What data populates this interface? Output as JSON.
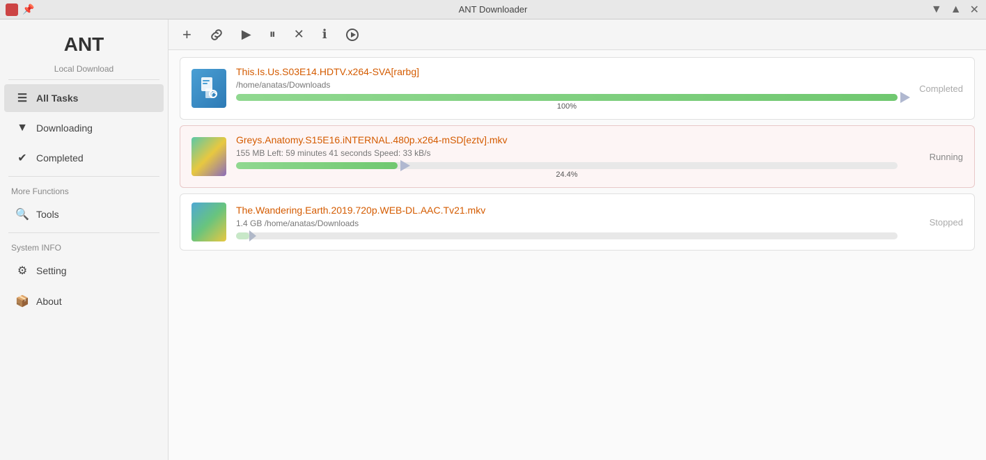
{
  "titlebar": {
    "title": "ANT Downloader",
    "pin_icon": "📌",
    "minimize": "▼",
    "maximize": "▲",
    "close": "✕"
  },
  "sidebar": {
    "logo": "ANT",
    "section_local": "Local Download",
    "items": [
      {
        "id": "all-tasks",
        "label": "All Tasks",
        "icon": "☰",
        "active": true
      },
      {
        "id": "downloading",
        "label": "Downloading",
        "icon": "▼",
        "active": false
      },
      {
        "id": "completed",
        "label": "Completed",
        "icon": "✔",
        "active": false
      }
    ],
    "section_more": "More Functions",
    "more_items": [
      {
        "id": "tools",
        "label": "Tools",
        "icon": "🔍",
        "active": false
      }
    ],
    "section_system": "System INFO",
    "system_items": [
      {
        "id": "setting",
        "label": "Setting",
        "icon": "⚙",
        "active": false
      },
      {
        "id": "about",
        "label": "About",
        "icon": "📦",
        "active": false
      }
    ]
  },
  "toolbar": {
    "buttons": [
      {
        "id": "add",
        "icon": "+",
        "title": "Add"
      },
      {
        "id": "link",
        "icon": "🔗",
        "title": "Link"
      },
      {
        "id": "start",
        "icon": "▶",
        "title": "Start"
      },
      {
        "id": "pause",
        "icon": "⏸",
        "title": "Pause"
      },
      {
        "id": "stop",
        "icon": "✕",
        "title": "Stop"
      },
      {
        "id": "info",
        "icon": "ℹ",
        "title": "Info"
      },
      {
        "id": "play",
        "icon": "▶️",
        "title": "Play"
      }
    ]
  },
  "downloads": [
    {
      "id": "dl1",
      "name": "This.Is.Us.S03E14.HDTV.x264-SVA[rarbg]",
      "path": "/home/anatas/Downloads",
      "status": "Completed",
      "status_key": "completed",
      "progress": 100,
      "progress_label": "100%",
      "type": "torrent"
    },
    {
      "id": "dl2",
      "name": "Greys.Anatomy.S15E16.iNTERNAL.480p.x264-mSD[eztv].mkv",
      "meta": "155 MB Left: 59 minutes 41 seconds Speed: 33 kB/s",
      "status": "Running",
      "status_key": "running",
      "progress": 24.4,
      "progress_label": "24.4%",
      "type": "video"
    },
    {
      "id": "dl3",
      "name": "The.Wandering.Earth.2019.720p.WEB-DL.AAC.Tv21.mkv",
      "meta": "1.4 GB  /home/anatas/Downloads",
      "status": "Stopped",
      "status_key": "stopped",
      "progress": 2,
      "progress_label": "",
      "type": "video2"
    }
  ],
  "colors": {
    "accent_orange": "#d45b00",
    "sidebar_bg": "#f5f5f5",
    "active_bg": "#e0e0e0",
    "progress_green": "#70c870"
  }
}
